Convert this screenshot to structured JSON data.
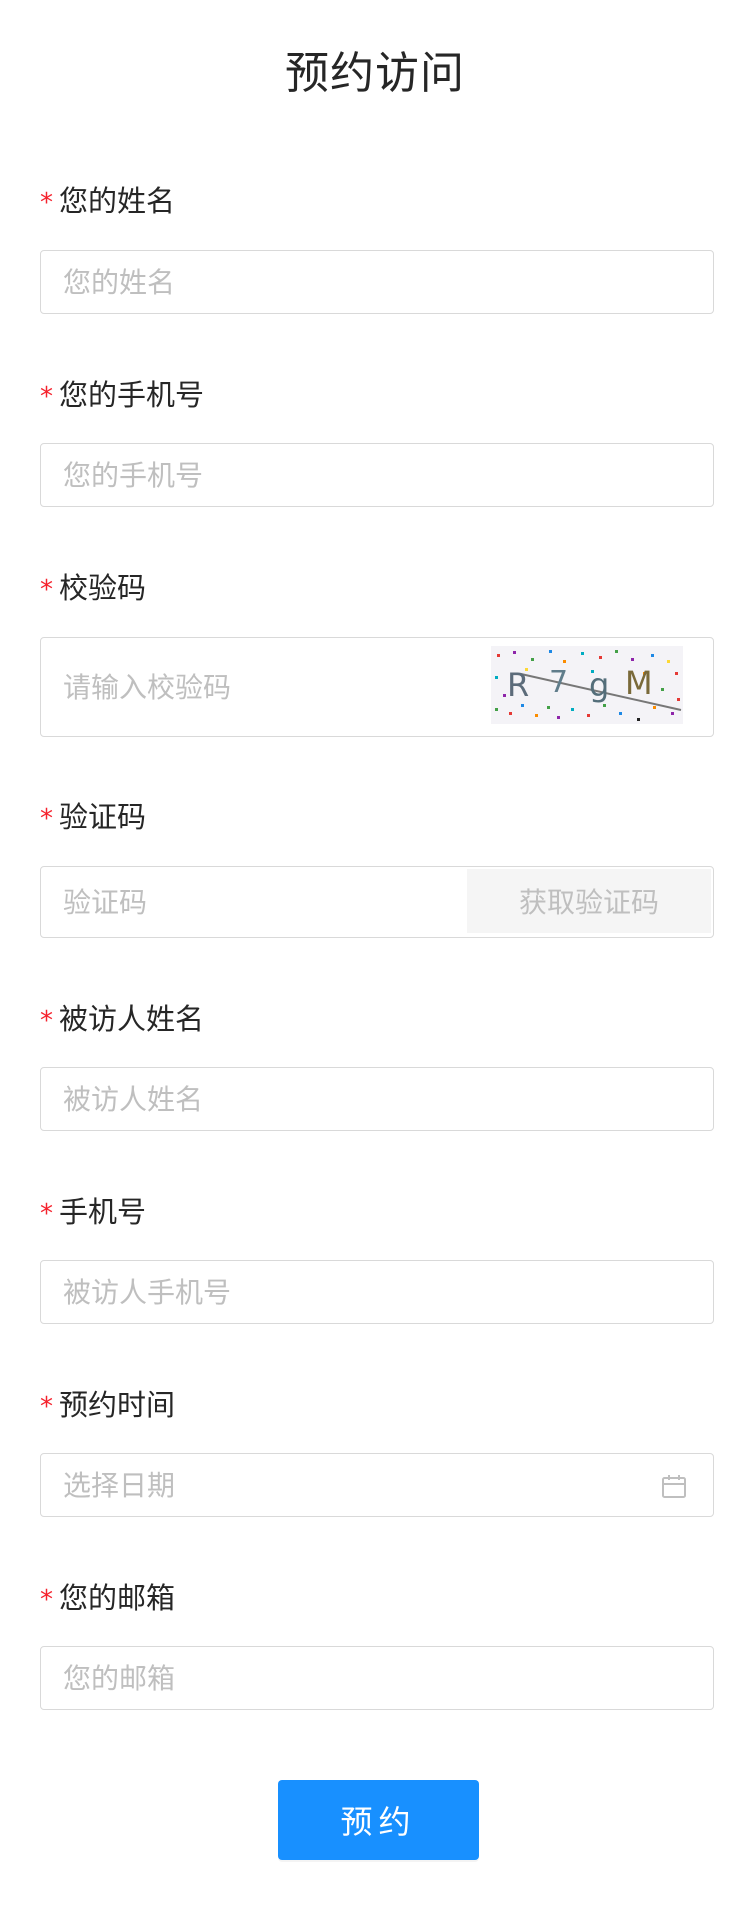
{
  "page": {
    "title": "预约访问",
    "required_mark": "*"
  },
  "fields": {
    "name": {
      "label": "您的姓名",
      "placeholder": "您的姓名",
      "value": ""
    },
    "phone": {
      "label": "您的手机号",
      "placeholder": "您的手机号",
      "value": ""
    },
    "captcha": {
      "label": "校验码",
      "placeholder": "请输入校验码",
      "value": "",
      "image_chars": [
        "R",
        "7",
        "g",
        "M"
      ]
    },
    "sms_code": {
      "label": "验证码",
      "placeholder": "验证码",
      "value": "",
      "button_label": "获取验证码"
    },
    "visitee_name": {
      "label": "被访人姓名",
      "placeholder": "被访人姓名",
      "value": ""
    },
    "visitee_phone": {
      "label": "手机号",
      "placeholder": "被访人手机号",
      "value": ""
    },
    "visit_time": {
      "label": "预约时间",
      "placeholder": "选择日期",
      "value": "",
      "icon": "calendar-icon"
    },
    "email": {
      "label": "您的邮箱",
      "placeholder": "您的邮箱",
      "value": ""
    }
  },
  "submit": {
    "label": "预约"
  },
  "colors": {
    "primary": "#1890ff",
    "required": "#f5222d",
    "border": "#d9d9d9",
    "placeholder": "#bfbfbf",
    "disabled_bg": "#f5f5f5"
  }
}
